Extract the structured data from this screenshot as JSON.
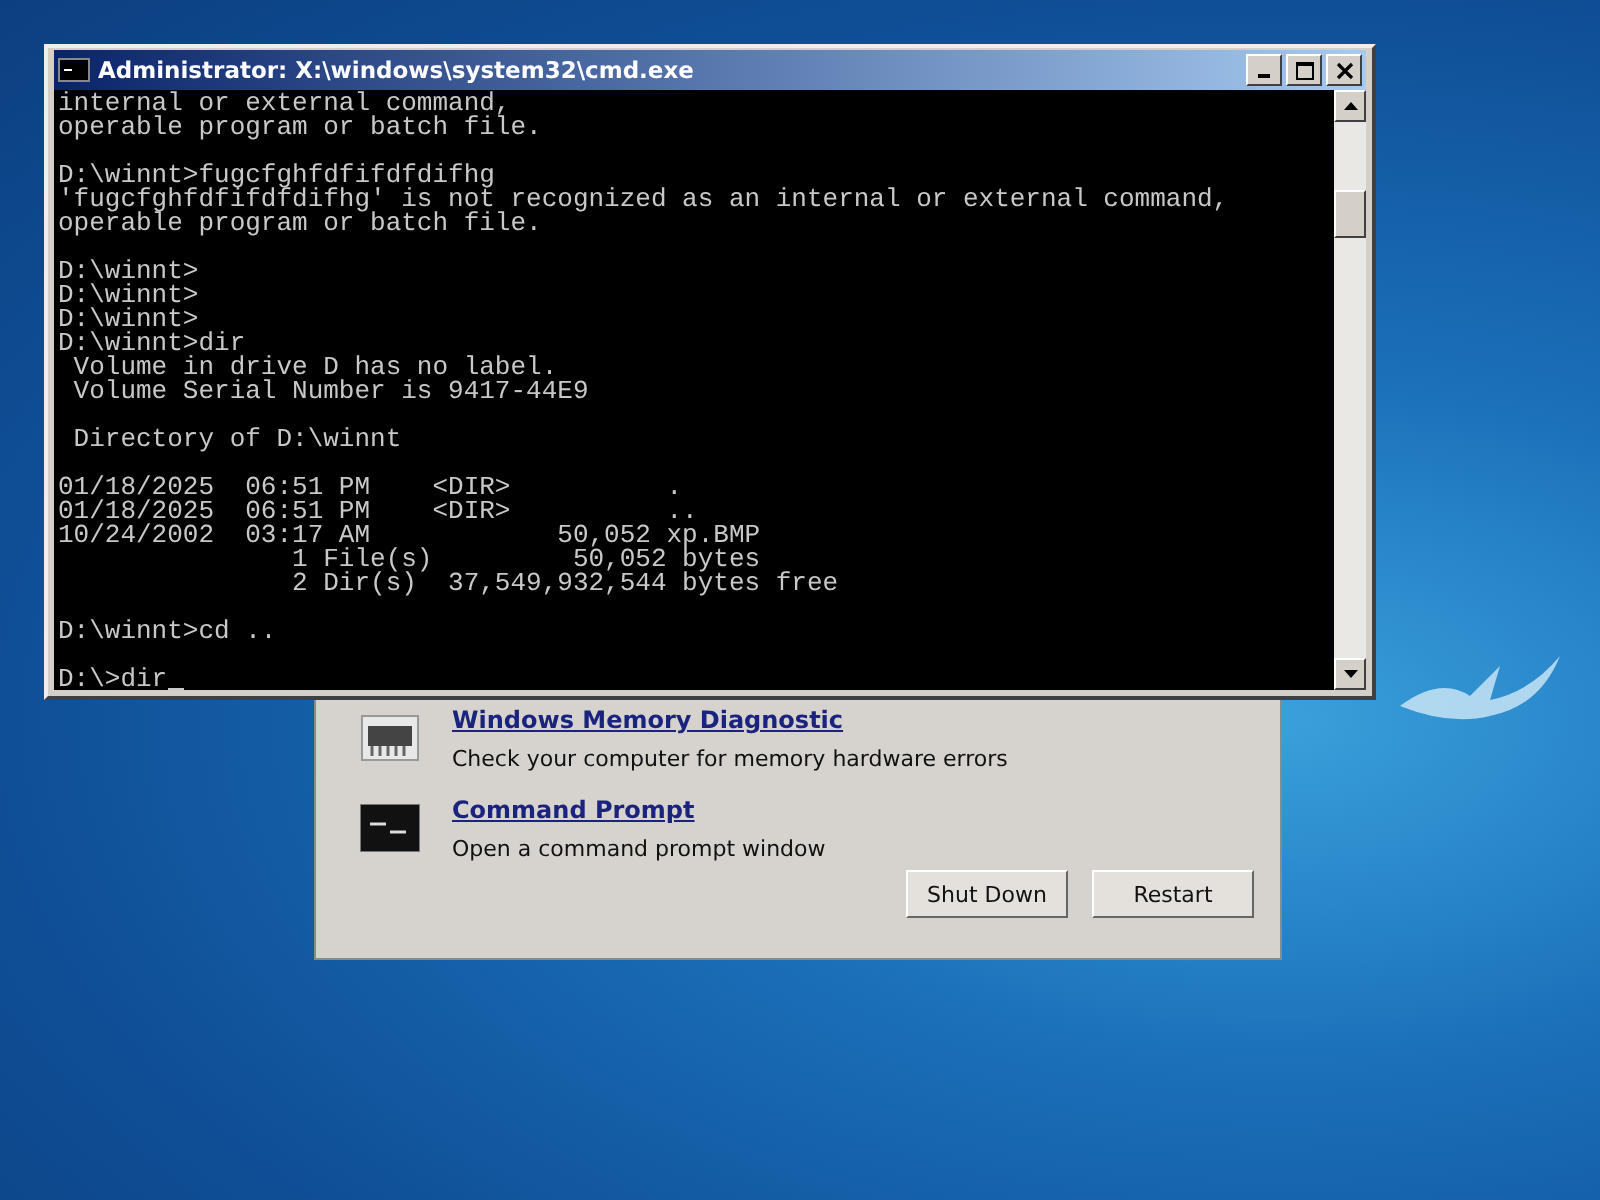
{
  "console_window": {
    "title": "Administrator: X:\\windows\\system32\\cmd.exe",
    "blocks": [
      [
        "internal or external command,",
        "operable program or batch file."
      ],
      [
        "D:\\winnt>fugcfghfdfifdfdifhg",
        "'fugcfghfdfifdfdifhg' is not recognized as an internal or external command,",
        "operable program or batch file."
      ],
      [
        "D:\\winnt>",
        "D:\\winnt>",
        "D:\\winnt>",
        "D:\\winnt>dir",
        " Volume in drive D has no label.",
        " Volume Serial Number is 9417-44E9"
      ],
      [
        " Directory of D:\\winnt"
      ],
      [
        "01/18/2025  06:51 PM    <DIR>          .",
        "01/18/2025  06:51 PM    <DIR>          ..",
        "10/24/2002  03:17 AM            50,052 xp.BMP",
        "               1 File(s)         50,052 bytes",
        "               2 Dir(s)  37,549,932,544 bytes free"
      ],
      [
        "D:\\winnt>cd .."
      ],
      [
        "D:\\>dir"
      ]
    ]
  },
  "recovery_dialog": {
    "tools": [
      {
        "kind": "memory",
        "name": "Windows Memory Diagnostic",
        "description": "Check your computer for memory hardware errors"
      },
      {
        "kind": "prompt",
        "name": "Command Prompt",
        "description": "Open a command prompt window"
      }
    ],
    "buttons": [
      "Shut Down",
      "Restart"
    ]
  }
}
